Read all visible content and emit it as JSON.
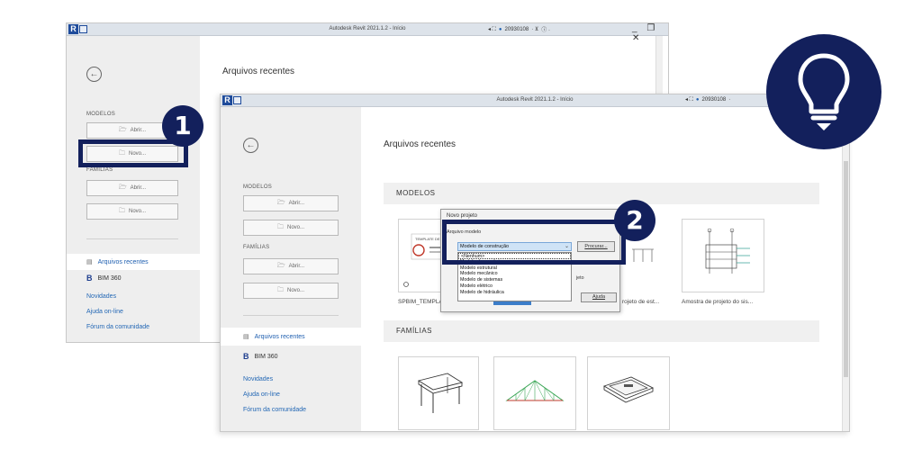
{
  "app": {
    "title": "Autodesk Revit 2021.1.2 - Início",
    "logo_letter": "R",
    "user_id": "20930108",
    "window_controls": "_ ❐ ✕"
  },
  "home": {
    "recent_title": "Arquivos recentes",
    "modelos_label": "MODELOS",
    "familias_label": "FAMÍLIAS",
    "abrir_label": "Abrir...",
    "novo_label": "Novo...",
    "nav_recent": "Arquivos recentes",
    "nav_bim360": "BIM 360",
    "bim_letter": "B",
    "links": [
      "Novidades",
      "Ajuda on-line",
      "Fórum da comunidade"
    ]
  },
  "front": {
    "section_modelos": "MODELOS",
    "section_familias": "FAMÍLIAS",
    "model_captions": [
      "SPBIM_TEMPLA",
      "rojeto de est...",
      "Amostra de projeto do sis..."
    ]
  },
  "dialog": {
    "title": "Novo projeto",
    "group_label": "Arquivo modelo",
    "selected": "Modelo de construção",
    "procurar": "Procurar...",
    "options": [
      "<Nenhum>",
      "Modelo de arquitetura",
      "Modelo estrutural",
      "Modelo mecânico",
      "Modelo de sistemas",
      "Modelo elétrico",
      "Modelo de hidráulica"
    ],
    "projeto_label": "jeto",
    "ajuda": "Ajuda"
  },
  "annotations": {
    "step1": "1",
    "step2": "2"
  },
  "colors": {
    "annotation": "#13205c",
    "link": "#2468b5"
  }
}
